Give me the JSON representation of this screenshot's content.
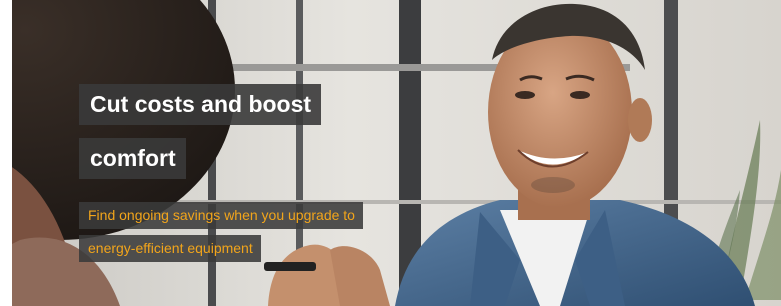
{
  "hero": {
    "headline_line1": "Cut costs and boost",
    "headline_line2": "comfort",
    "subtext_line1": "Find ongoing savings when you upgrade to",
    "subtext_line2": "energy-efficient equipment"
  },
  "colors": {
    "headline_text": "#ffffff",
    "subtext_text": "#f2a51b",
    "text_box_background": "#3a3a3a"
  }
}
